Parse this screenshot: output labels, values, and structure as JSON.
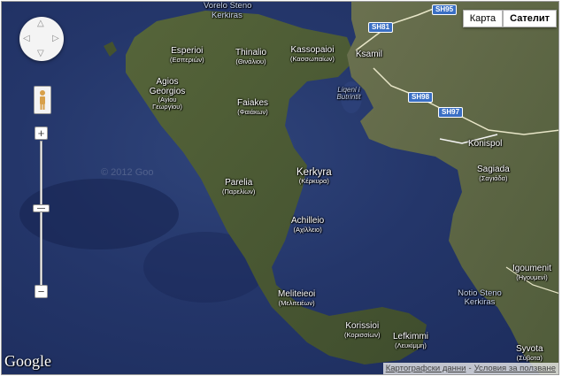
{
  "map_type": {
    "map": "Карта",
    "satellite": "Сателит",
    "active": "satellite"
  },
  "places": [
    {
      "id": "vorelo",
      "main": "Vorelo Steno",
      "sub": ""
    },
    {
      "id": "kerkiras_top",
      "main": "Kerkiras",
      "sub": ""
    },
    {
      "id": "esperioi",
      "main": "Esperioi",
      "sub": "(Εσπεριών)"
    },
    {
      "id": "thinalio",
      "main": "Thinalio",
      "sub": "(Θινάλιου)"
    },
    {
      "id": "kassopaioi",
      "main": "Kassopaioi",
      "sub": "(Κασσωπαίων)"
    },
    {
      "id": "ksamil",
      "main": "Ksamil",
      "sub": ""
    },
    {
      "id": "agios",
      "main": "Agios Georgios",
      "sub": "(Αγίου Γεωργίου)"
    },
    {
      "id": "faiakes",
      "main": "Faiakes",
      "sub": "(Φαιάκων)"
    },
    {
      "id": "liqeni",
      "main": "Liqeni i Butrintit",
      "sub": ""
    },
    {
      "id": "konispol",
      "main": "Konispol",
      "sub": ""
    },
    {
      "id": "kerkyra",
      "main": "Kerkyra",
      "sub": "(Κέρκυρα)"
    },
    {
      "id": "sagiada",
      "main": "Sagiada",
      "sub": "(Σαγιάδα)"
    },
    {
      "id": "parelia",
      "main": "Parelia",
      "sub": "(Παρελίων)"
    },
    {
      "id": "achilleio",
      "main": "Achilleio",
      "sub": "(Αχίλλειο)"
    },
    {
      "id": "igoumenitsa",
      "main": "Igoumenit",
      "sub": "(Ηγουμενί)"
    },
    {
      "id": "notio",
      "main": "Notio Steno Kerkiras",
      "sub": ""
    },
    {
      "id": "meliteieoi",
      "main": "Meliteieoi",
      "sub": "(Μελιτειέων)"
    },
    {
      "id": "korissioi",
      "main": "Korissioi",
      "sub": "(Κορισσίων)"
    },
    {
      "id": "lefkimmi",
      "main": "Lefkimmi",
      "sub": "(Λευκίμμη)"
    },
    {
      "id": "syvota",
      "main": "Syvota",
      "sub": "(Σύβοτα)"
    }
  ],
  "roads": {
    "sh95": "SH95",
    "sh81": "SH81",
    "sh98": "SH98",
    "sh97": "SH97"
  },
  "watermark": "© 2012 Goo",
  "logo": "Google",
  "footer": {
    "map_data": "Картографски данни",
    "separator": "-",
    "terms": "Условия за ползване"
  },
  "colors": {
    "water": "#24366a",
    "land": "#4b5a34",
    "road": "#e8e6c8",
    "highway_shield": "#3a6fc4"
  }
}
